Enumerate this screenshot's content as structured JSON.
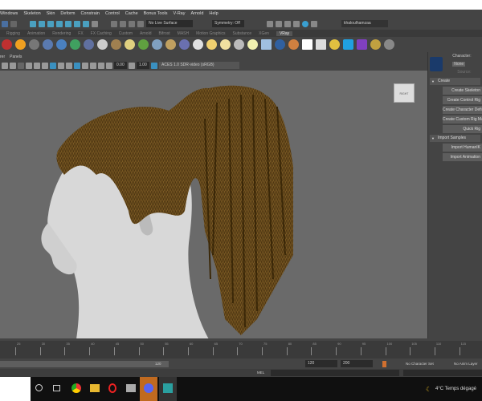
{
  "menu": [
    "Windows",
    "Skeleton",
    "Skin",
    "Deform",
    "Constrain",
    "Control",
    "Cache",
    "Bonus Tools",
    "V-Ray",
    "Arnold",
    "Help"
  ],
  "status": {
    "live_surface": "No Live Surface",
    "symmetry": "Symmetry: Off",
    "user": "khaloulhamzaa"
  },
  "shelf_tabs": [
    "Rigging",
    "Animation",
    "Rendering",
    "FX",
    "FX Caching",
    "Custom",
    "Arnold",
    "Bifrost",
    "MASH",
    "Motion Graphics",
    "Substance",
    "XGen",
    "VRay"
  ],
  "active_shelf": "VRay",
  "panel_menu": [
    "rer",
    "Panels"
  ],
  "viewport_toolbar": {
    "exposure": "0.00",
    "gamma": "1.00",
    "color_space": "ACES 1.0 SDR-video (sRGB)"
  },
  "viewcube": "RIGHT",
  "right_panel": {
    "character_label": "Character:",
    "character_value": "None",
    "source_label": "Source:",
    "create_header": "Create",
    "create_buttons": [
      "Create Skeleton",
      "Create Control Rig",
      "Create Character Definition",
      "Create Custom Rig Mapping",
      "Quick Rig"
    ],
    "import_header": "Import Samples",
    "import_buttons": [
      "Import HumanIK",
      "Import Animation"
    ]
  },
  "timeline_ticks": [
    "25",
    "30",
    "35",
    "40",
    "45",
    "50",
    "55",
    "60",
    "65",
    "70",
    "75",
    "80",
    "85",
    "90",
    "95",
    "100",
    "105",
    "110",
    "115"
  ],
  "range": {
    "end_slider": "120",
    "playback_end": "120",
    "anim_end": "200",
    "character_set": "No Character Set",
    "anim_layer": "No Anim Layer"
  },
  "cmd": {
    "label": "MEL"
  },
  "taskbar": {
    "weather": "4°C  Temps dégagé"
  }
}
